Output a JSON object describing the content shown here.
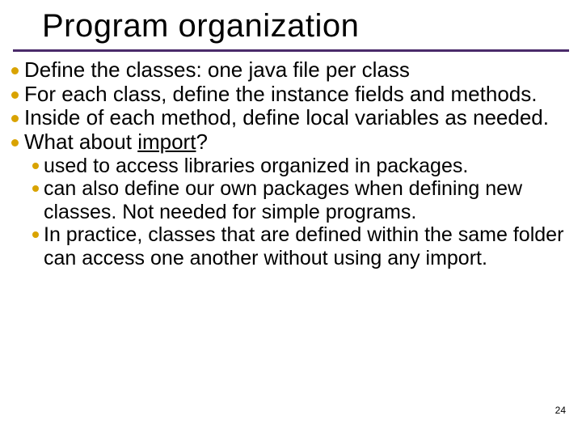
{
  "title": "Program organization",
  "bullets": [
    {
      "text": "Define the classes: one java file per class"
    },
    {
      "text": "For each class, define the instance fields and methods."
    },
    {
      "text": "Inside of each method, define local variables as needed."
    },
    {
      "prefix": "What about ",
      "underlined": "import",
      "suffix": "?"
    }
  ],
  "subbullets": [
    {
      "text": "used to access libraries organized in packages."
    },
    {
      "text": "can also define our own packages when defining new classes. Not needed for simple programs."
    },
    {
      "text": "In practice, classes that are defined within the same folder can access one another without using any import."
    }
  ],
  "page_number": "24"
}
